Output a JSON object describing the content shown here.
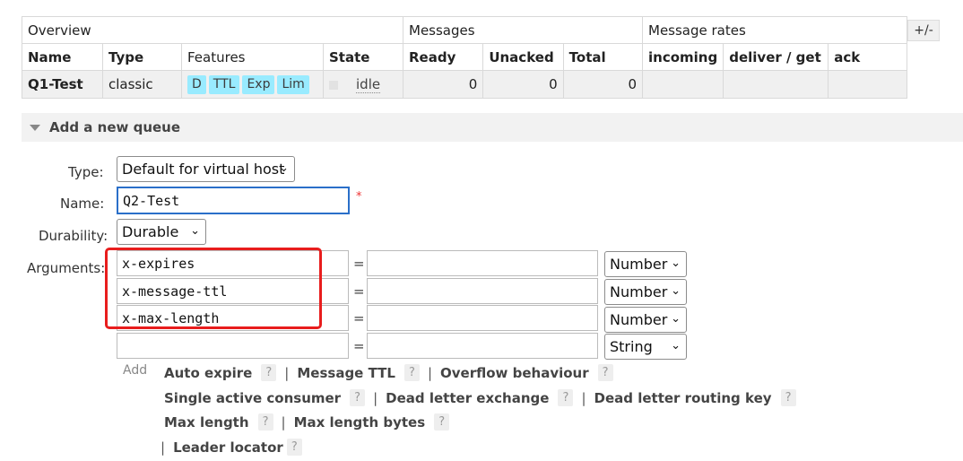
{
  "table": {
    "groups": [
      "Overview",
      "Messages",
      "Message rates"
    ],
    "columns": [
      "Name",
      "Type",
      "Features",
      "State",
      "Ready",
      "Unacked",
      "Total",
      "incoming",
      "deliver / get",
      "ack"
    ],
    "row": {
      "name": "Q1-Test",
      "type": "classic",
      "features": [
        "D",
        "TTL",
        "Exp",
        "Lim"
      ],
      "state": "idle",
      "ready": "0",
      "unacked": "0",
      "total": "0",
      "incoming": "",
      "deliver_get": "",
      "ack": ""
    },
    "toggle_label": "+/-"
  },
  "section": {
    "title": "Add a new queue"
  },
  "form": {
    "type_label": "Type:",
    "type_value": "Default for virtual host",
    "name_label": "Name:",
    "name_value": "Q2-Test",
    "required_mark": "*",
    "durability_label": "Durability:",
    "durability_value": "Durable",
    "arguments_label": "Arguments:",
    "arguments": [
      {
        "key": "x-expires",
        "value": "",
        "type": "Number"
      },
      {
        "key": "x-message-ttl",
        "value": "",
        "type": "Number"
      },
      {
        "key": "x-max-length",
        "value": "",
        "type": "Number"
      },
      {
        "key": "",
        "value": "",
        "type": "String"
      }
    ],
    "equals": "=",
    "add_label": "Add"
  },
  "helpers": {
    "line1": [
      "Auto expire",
      "Message TTL",
      "Overflow behaviour"
    ],
    "line2": [
      "Single active consumer",
      "Dead letter exchange",
      "Dead letter routing key"
    ],
    "line3": [
      "Max length",
      "Max length bytes"
    ],
    "line4": [
      "Leader locator"
    ],
    "help_mark": "?",
    "separator": "|"
  },
  "colors": {
    "feature_chip": "#99ebff",
    "focus": "#2a6fc9",
    "highlight": "#e81d1d"
  }
}
